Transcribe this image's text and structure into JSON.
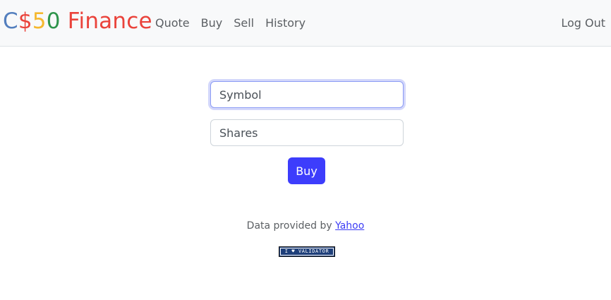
{
  "brand": {
    "parts": [
      {
        "text": "C",
        "color": "#537fbe"
      },
      {
        "text": "$",
        "color": "#ea433b"
      },
      {
        "text": "5",
        "color": "#f5b82e"
      },
      {
        "text": "0",
        "color": "#2e944b"
      },
      {
        "text": " Finance",
        "color": "#ea433b"
      }
    ]
  },
  "nav": {
    "items": [
      {
        "label": "Quote"
      },
      {
        "label": "Buy"
      },
      {
        "label": "Sell"
      },
      {
        "label": "History"
      }
    ],
    "logout_label": "Log Out"
  },
  "form": {
    "symbol_placeholder": "Symbol",
    "shares_placeholder": "Shares",
    "buy_label": "Buy"
  },
  "footer": {
    "prefix": "Data provided by ",
    "link_label": "Yahoo",
    "validator_label": "I ♥ VALIDATOR"
  },
  "colors": {
    "primary_button": "#3d3dfc",
    "navbar_bg": "#f8f9fa",
    "link": "#3c3cf5"
  }
}
